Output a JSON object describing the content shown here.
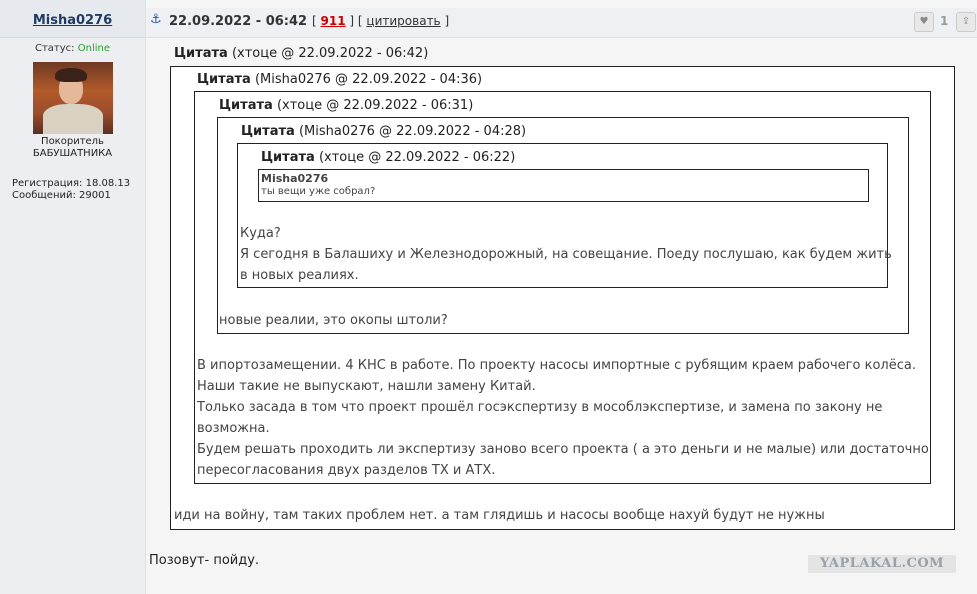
{
  "user": {
    "name": "Misha0276",
    "status_label": "Статус:",
    "status_value": "Online",
    "rank_line1": "Покоритель",
    "rank_line2": "БАБУШАТНИКА",
    "registration": "Регистрация: 18.08.13",
    "messages": "Сообщений: 29001"
  },
  "post": {
    "anchor_icon": "anchor-icon",
    "date": "22.09.2022 - 06:42",
    "meta_open": "[",
    "number": "911",
    "meta_mid": "] [",
    "quote_label": "цитировать",
    "meta_close": "]",
    "like_count": "1"
  },
  "quotes": {
    "label": "Цитата",
    "q1_meta": "(хтоце @ 22.09.2022 - 06:42)",
    "q2_meta": "(Misha0276 @ 22.09.2022 - 04:36)",
    "q3_meta": "(хтоце @ 22.09.2022 - 06:31)",
    "q4_meta": "(Misha0276 @ 22.09.2022 - 04:28)",
    "q5_meta": "(хтоце @ 22.09.2022 - 06:22)",
    "q6_author": "Misha0276",
    "q6_text": "ты вещи уже собрал?",
    "q5_text": [
      "Куда?",
      "Я сегодня в Балашиху и Железнодорожный, на совещание. Поеду послушаю, как будем жить",
      "в новых реалиях."
    ],
    "q4_text": "новые реалии, это окопы штоли?",
    "q3_text": [
      "В ипортозамещении. 4 КНС в работе. По проекту насосы импортные с рубящим краем рабочего колёса.",
      "Наши такие не выпускают, нашли замену Китай.",
      "Только засада в том что проект прошёл госэкспертизу в мособлэкспертизе, и замена по закону не",
      "возможна.",
      "Будем решать проходить ли экспертизу заново всего проекта ( а это деньги и не малые) или достаточно",
      "пересогласования двух разделов ТХ и АТХ."
    ],
    "q2_text": "иди на войну, там таких проблем нет. а там глядишь и насосы вообще нахуй будут не нужны"
  },
  "reply": "Позовут- пойду.",
  "watermark": "YAPLAKAL.COM"
}
